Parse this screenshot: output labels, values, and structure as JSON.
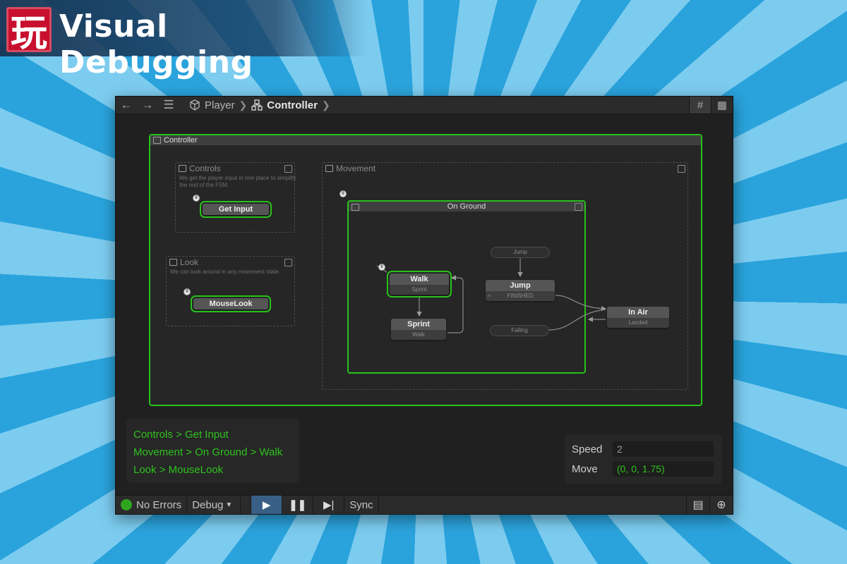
{
  "banner": {
    "logo_char": "玩",
    "title": "Visual Debugging"
  },
  "toolbar": {
    "breadcrumbs": [
      {
        "label": "Player",
        "icon": "cube-icon"
      },
      {
        "label": "Controller",
        "icon": "hierarchy-icon"
      }
    ]
  },
  "graph": {
    "root_fsm": {
      "label": "Controller"
    },
    "controls_group": {
      "label": "Controls",
      "note": "We get the player input in one place to simplify the rest of the FSM.",
      "state": "Get Input",
      "start_marker": "0"
    },
    "look_group": {
      "label": "Look",
      "note": "We can look around in any movement state.",
      "state": "MouseLook",
      "start_marker": "0"
    },
    "movement_group": {
      "label": "Movement",
      "start_marker": "0",
      "on_ground": {
        "label": "On Ground",
        "start_marker": "0",
        "walk": {
          "title": "Walk",
          "transition": "Sprint"
        },
        "sprint": {
          "title": "Sprint",
          "transition": "Walk"
        },
        "jump": {
          "title": "Jump",
          "transition": "FINISHED",
          "event": "Jump"
        },
        "falling_event": "Falling"
      },
      "in_air": {
        "title": "In Air",
        "transition": "Landed"
      }
    }
  },
  "active_states": [
    "Controls > Get Input",
    "Movement > On Ground > Walk",
    "Look > MouseLook"
  ],
  "variables": {
    "speed": {
      "label": "Speed",
      "value": "2"
    },
    "move": {
      "label": "Move",
      "value": "(0, 0, 1.75)"
    }
  },
  "bottombar": {
    "status": "No Errors",
    "mode": "Debug",
    "sync": "Sync"
  },
  "colors": {
    "active_green": "#28c21a",
    "play_button": "#3a5f86",
    "logo_red": "#c8102e"
  }
}
